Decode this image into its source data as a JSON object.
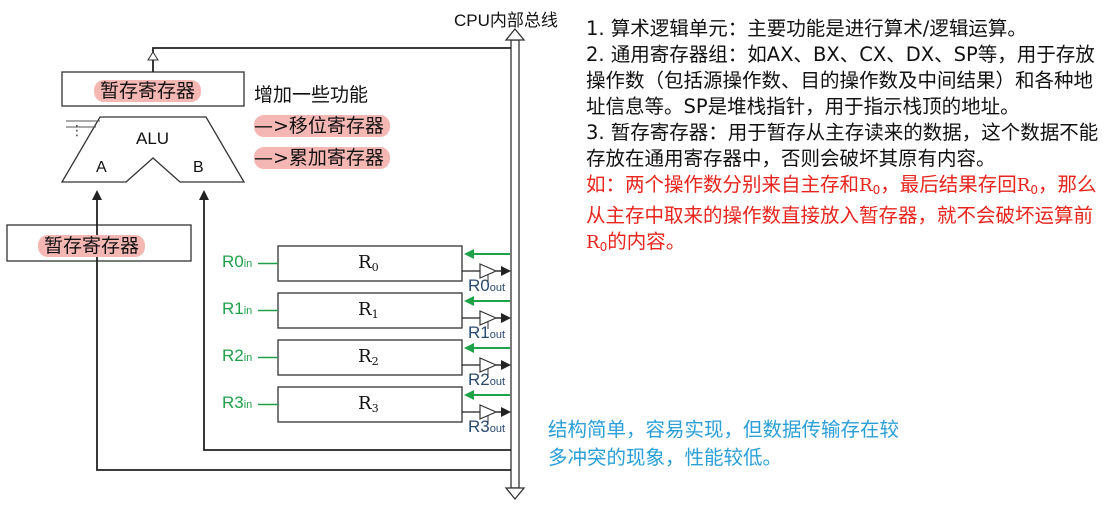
{
  "bus_label": "CPU内部总线",
  "temp_reg_top_label": "暂存寄存器",
  "temp_reg_left_label": "暂存寄存器",
  "alu_label": "ALU",
  "alu_input_a": "A",
  "alu_input_b": "B",
  "alu_addon_title": "增加一些功能",
  "alu_addon_items": [
    "—>移位寄存器",
    "—>累加寄存器"
  ],
  "registers": [
    {
      "name": "R",
      "index": "0",
      "in_label": "R0",
      "in_sub": "in",
      "out_label": "R0",
      "out_sub": "out"
    },
    {
      "name": "R",
      "index": "1",
      "in_label": "R1",
      "in_sub": "in",
      "out_label": "R1",
      "out_sub": "out"
    },
    {
      "name": "R",
      "index": "2",
      "in_label": "R2",
      "in_sub": "in",
      "out_label": "R2",
      "out_sub": "out"
    },
    {
      "name": "R",
      "index": "3",
      "in_label": "R3",
      "in_sub": "in",
      "out_label": "R3",
      "out_sub": "out"
    }
  ],
  "notes": {
    "alu": "1. 算术逻辑单元：主要功能是进行算术/逻辑运算。",
    "gpr": "2. 通用寄存器组：如AX、BX、CX、DX、SP等，用于存放操作数（包括源操作数、目的操作数及中间结果）和各种地址信息等。SP是堆栈指针，用于指示栈顶的地址。",
    "temp": "3. 暂存寄存器：用于暂存从主存读来的数据，这个数据不能存放在通用寄存器中，否则会破坏其原有内容。",
    "example": {
      "p1": "如：两个操作数分别来自主存和",
      "p2": "，最后结果存回",
      "p3": "，那么从主存中取来的操作数直接放入暂存器，就不会破坏运算前",
      "p4": "的内容。",
      "reg_name": "R",
      "reg_index": "0"
    }
  },
  "summary": "结构简单，容易实现，但数据传输存在较多冲突的现象，性能较低。",
  "colors": {
    "highlight": "#f5b7b4",
    "red_text": "#e8241d",
    "blue_text": "#2a9fd8",
    "green_arrow": "#1fa14a"
  }
}
